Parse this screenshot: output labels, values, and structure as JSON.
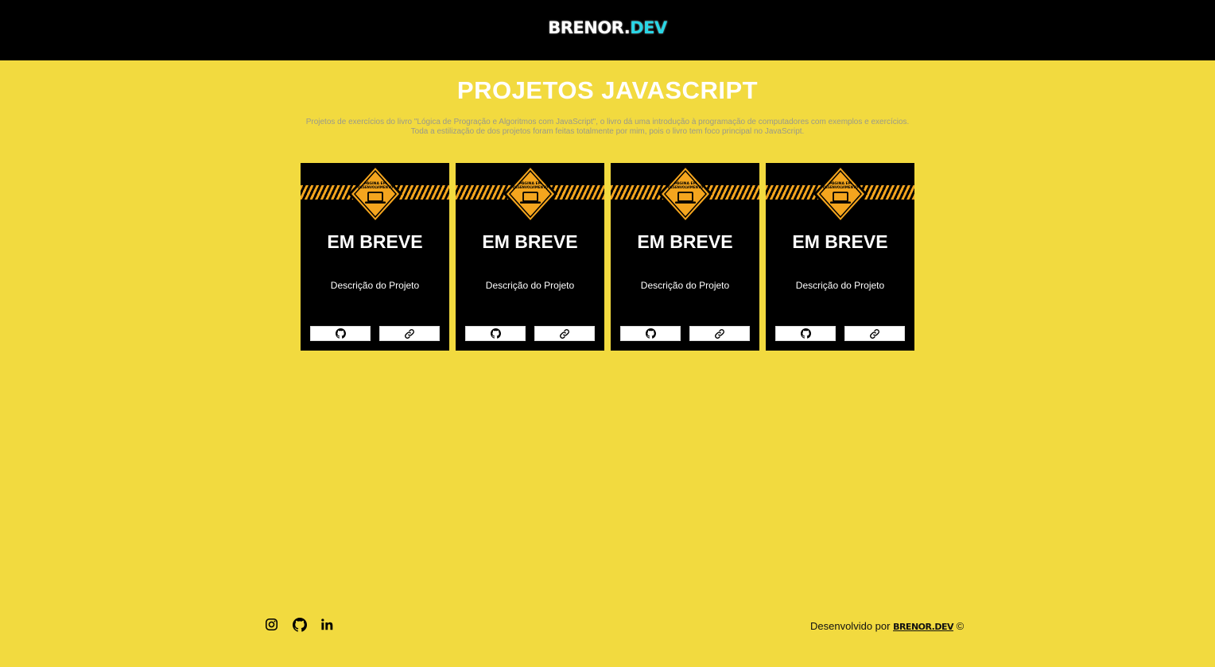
{
  "header": {
    "logo_main": "BRENOR",
    "logo_dot": ".",
    "logo_accent": "DEV",
    "accent_color": "#29d6e6"
  },
  "main": {
    "title": "PROJETOS JAVASCRIPT",
    "subtitle_line1": "Projetos de exercícios do livro \"Lógica de Progração e Algoritmos com JavaScript\", o livro dá uma introdução à programação de computadores com exemplos e exercícios.",
    "subtitle_line2": "Toda a estilização de dos projetos foram feitas totalmente por mim, pois o livro tem foco principal no JavaScript."
  },
  "cards": [
    {
      "sign_text_1": "PÁGINA EM",
      "sign_text_2": "DESENVOLVIMENTO",
      "title": "EM BREVE",
      "description": "Descrição do Projeto",
      "github_icon": "github-icon",
      "link_icon": "link-icon"
    },
    {
      "sign_text_1": "PÁGINA EM",
      "sign_text_2": "DESENVOLVIMENTO",
      "title": "EM BREVE",
      "description": "Descrição do Projeto",
      "github_icon": "github-icon",
      "link_icon": "link-icon"
    },
    {
      "sign_text_1": "PÁGINA EM",
      "sign_text_2": "DESENVOLVIMENTO",
      "title": "EM BREVE",
      "description": "Descrição do Projeto",
      "github_icon": "github-icon",
      "link_icon": "link-icon"
    },
    {
      "sign_text_1": "PÁGINA EM",
      "sign_text_2": "DESENVOLVIMENTO",
      "title": "EM BREVE",
      "description": "Descrição do Projeto",
      "github_icon": "github-icon",
      "link_icon": "link-icon"
    }
  ],
  "footer": {
    "social_icons": [
      "instagram-icon",
      "github-icon",
      "linkedin-icon"
    ],
    "credit_prefix": "Desenvolvido por",
    "credit_link": "BRENOR.DEV",
    "credit_suffix": "©"
  },
  "colors": {
    "background": "#f2da3f",
    "header": "#000000",
    "card": "#000000",
    "sign": "#f4a51e"
  }
}
